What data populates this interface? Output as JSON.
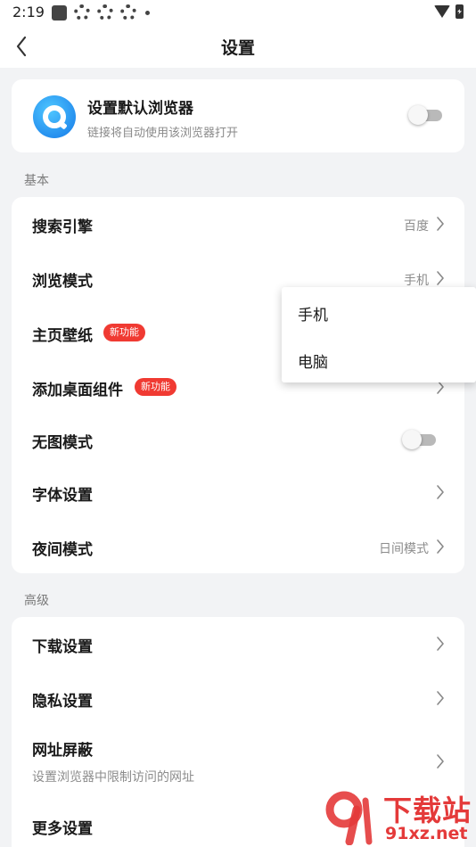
{
  "status_bar": {
    "time": "2:19"
  },
  "header": {
    "title": "设置"
  },
  "default_browser": {
    "title": "设置默认浏览器",
    "subtitle": "链接将自动使用该浏览器打开",
    "enabled": false
  },
  "sections": {
    "basic": {
      "label": "基本",
      "items": [
        {
          "label": "搜索引擎",
          "value": "百度"
        },
        {
          "label": "浏览模式",
          "value": "手机"
        },
        {
          "label": "主页壁纸",
          "badge": "新功能"
        },
        {
          "label": "添加桌面组件",
          "badge": "新功能"
        },
        {
          "label": "无图模式",
          "enabled": false
        },
        {
          "label": "字体设置"
        },
        {
          "label": "夜间模式",
          "value": "日间模式"
        }
      ]
    },
    "advanced": {
      "label": "高级",
      "items": [
        {
          "label": "下载设置"
        },
        {
          "label": "隐私设置"
        },
        {
          "label": "网址屏蔽",
          "subtitle": "设置浏览器中限制访问的网址"
        },
        {
          "label": "更多设置"
        }
      ]
    }
  },
  "browse_mode_popup": {
    "options": [
      "手机",
      "电脑"
    ]
  },
  "watermark": {
    "title": "下载站",
    "domain": "91xz.net"
  },
  "colors": {
    "accent": "#1478e8",
    "badge": "#f03a32",
    "background": "#f2f3f5",
    "watermark": "#e43a3a"
  },
  "icons": {
    "back": "chevron-left-icon",
    "chevron": "chevron-right-icon",
    "browser_logo": "browser-q-logo-icon"
  }
}
